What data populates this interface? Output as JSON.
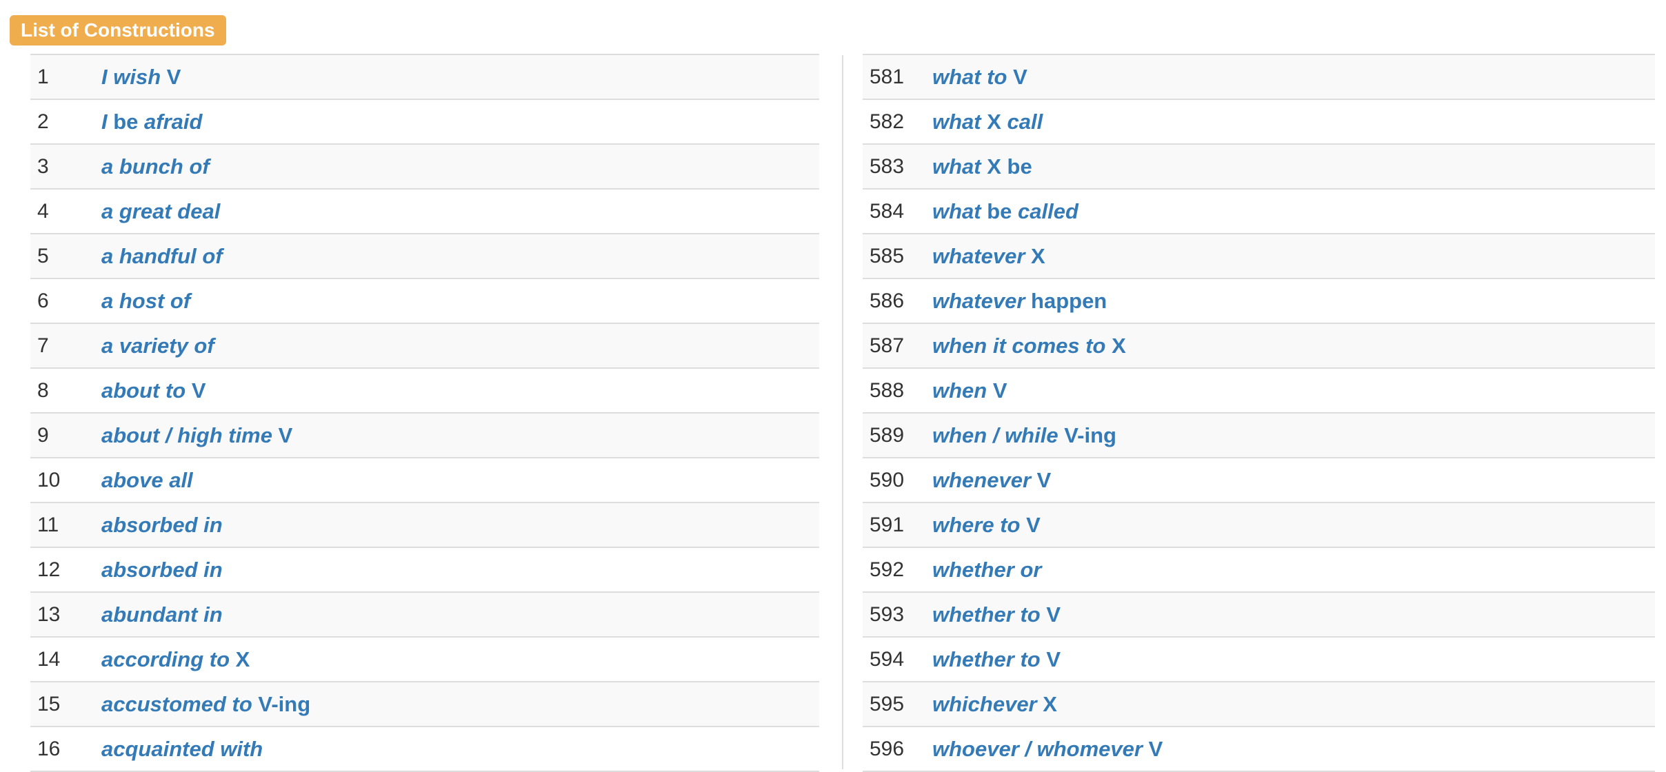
{
  "header": {
    "title": "List of Constructions"
  },
  "colors": {
    "accent": "#f0ad4e",
    "link": "#337ab7",
    "text": "#333333",
    "row_stripe": "#f9f9f9",
    "border": "#dddddd"
  },
  "left_rows": [
    {
      "num": "1",
      "parts": [
        {
          "t": "I wish",
          "i": true
        },
        {
          "t": " V",
          "i": false
        }
      ]
    },
    {
      "num": "2",
      "parts": [
        {
          "t": "I",
          "i": true
        },
        {
          "t": " be ",
          "i": false
        },
        {
          "t": "afraid",
          "i": true
        }
      ]
    },
    {
      "num": "3",
      "parts": [
        {
          "t": "a bunch of",
          "i": true
        }
      ]
    },
    {
      "num": "4",
      "parts": [
        {
          "t": "a great deal",
          "i": true
        }
      ]
    },
    {
      "num": "5",
      "parts": [
        {
          "t": "a handful of",
          "i": true
        }
      ]
    },
    {
      "num": "6",
      "parts": [
        {
          "t": "a host of",
          "i": true
        }
      ]
    },
    {
      "num": "7",
      "parts": [
        {
          "t": "a variety of",
          "i": true
        }
      ]
    },
    {
      "num": "8",
      "parts": [
        {
          "t": "about to",
          "i": true
        },
        {
          "t": " V",
          "i": false
        }
      ]
    },
    {
      "num": "9",
      "parts": [
        {
          "t": "about / high time",
          "i": true
        },
        {
          "t": " V",
          "i": false
        }
      ]
    },
    {
      "num": "10",
      "parts": [
        {
          "t": "above all",
          "i": true
        }
      ]
    },
    {
      "num": "11",
      "parts": [
        {
          "t": "absorbed in",
          "i": true
        }
      ]
    },
    {
      "num": "12",
      "parts": [
        {
          "t": "absorbed in",
          "i": true
        }
      ]
    },
    {
      "num": "13",
      "parts": [
        {
          "t": "abundant in",
          "i": true
        }
      ]
    },
    {
      "num": "14",
      "parts": [
        {
          "t": "according to",
          "i": true
        },
        {
          "t": " X",
          "i": false
        }
      ]
    },
    {
      "num": "15",
      "parts": [
        {
          "t": "accustomed to",
          "i": true
        },
        {
          "t": " V-ing",
          "i": false
        }
      ]
    },
    {
      "num": "16",
      "parts": [
        {
          "t": "acquainted with",
          "i": true
        }
      ]
    }
  ],
  "right_rows": [
    {
      "num": "581",
      "parts": [
        {
          "t": "what to",
          "i": true
        },
        {
          "t": " V",
          "i": false
        }
      ]
    },
    {
      "num": "582",
      "parts": [
        {
          "t": "what",
          "i": true
        },
        {
          "t": " X ",
          "i": false
        },
        {
          "t": "call",
          "i": true
        }
      ]
    },
    {
      "num": "583",
      "parts": [
        {
          "t": "what",
          "i": true
        },
        {
          "t": " X be",
          "i": false
        }
      ]
    },
    {
      "num": "584",
      "parts": [
        {
          "t": "what",
          "i": true
        },
        {
          "t": " be ",
          "i": false
        },
        {
          "t": "called",
          "i": true
        }
      ]
    },
    {
      "num": "585",
      "parts": [
        {
          "t": "whatever",
          "i": true
        },
        {
          "t": " X",
          "i": false
        }
      ]
    },
    {
      "num": "586",
      "parts": [
        {
          "t": "whatever",
          "i": true
        },
        {
          "t": " happen",
          "i": false
        }
      ]
    },
    {
      "num": "587",
      "parts": [
        {
          "t": "when it comes to",
          "i": true
        },
        {
          "t": " X",
          "i": false
        }
      ]
    },
    {
      "num": "588",
      "parts": [
        {
          "t": "when",
          "i": true
        },
        {
          "t": " V",
          "i": false
        }
      ]
    },
    {
      "num": "589",
      "parts": [
        {
          "t": "when / while",
          "i": true
        },
        {
          "t": " V-ing",
          "i": false
        }
      ]
    },
    {
      "num": "590",
      "parts": [
        {
          "t": "whenever",
          "i": true
        },
        {
          "t": " V",
          "i": false
        }
      ]
    },
    {
      "num": "591",
      "parts": [
        {
          "t": "where to",
          "i": true
        },
        {
          "t": " V",
          "i": false
        }
      ]
    },
    {
      "num": "592",
      "parts": [
        {
          "t": "whether or",
          "i": true
        }
      ]
    },
    {
      "num": "593",
      "parts": [
        {
          "t": "whether to",
          "i": true
        },
        {
          "t": " V",
          "i": false
        }
      ]
    },
    {
      "num": "594",
      "parts": [
        {
          "t": "whether to",
          "i": true
        },
        {
          "t": " V",
          "i": false
        }
      ]
    },
    {
      "num": "595",
      "parts": [
        {
          "t": "whichever",
          "i": true
        },
        {
          "t": " X",
          "i": false
        }
      ]
    },
    {
      "num": "596",
      "parts": [
        {
          "t": "whoever / whomever",
          "i": true
        },
        {
          "t": " V",
          "i": false
        }
      ]
    }
  ]
}
